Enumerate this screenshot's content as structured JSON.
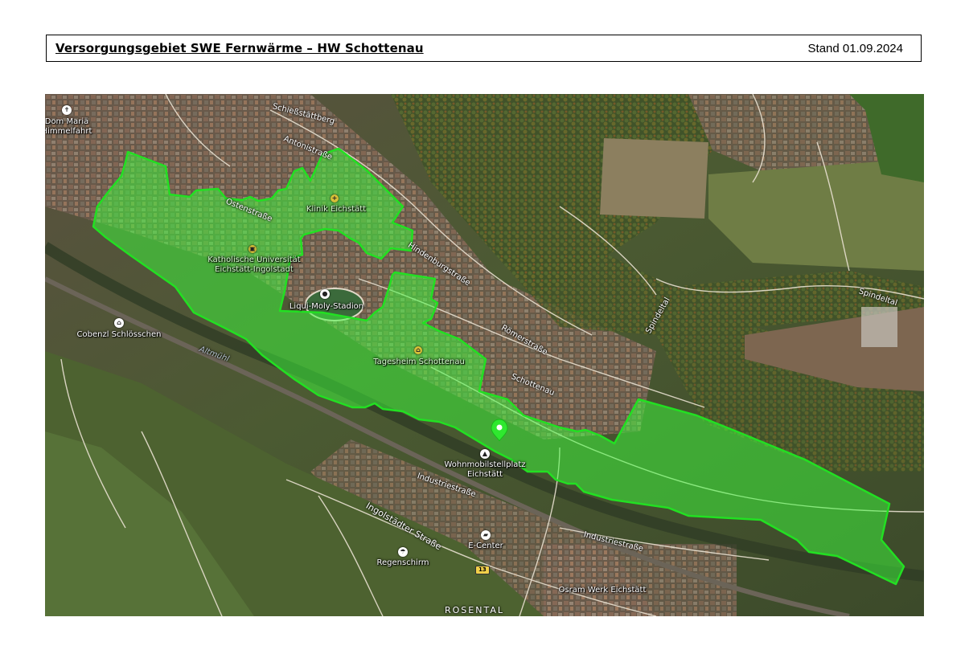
{
  "header": {
    "title": "Versorgungsgebiet SWE Fernwärme – HW Schottenau",
    "stand": "Stand 01.09.2024"
  },
  "map": {
    "places": {
      "dom": "Dom Mariä\nHimmelfahrt",
      "klinik": "Klinik Eichstätt",
      "uni": "Katholische Universität\nEichstätt-Ingolstadt",
      "stadion": "Liqui-Moly-Stadion",
      "cobenzl": "Cobenzl Schlösschen",
      "tagesheim": "Tagesheim Schottenau",
      "wohnmobil": "Wohnmobilstellplatz\nEichstätt",
      "ecenter": "E-Center",
      "regenschirm": "Regenschirm",
      "osram": "Osram Werk Eichstätt"
    },
    "roads": {
      "schiessstaette": "Schießstättberg",
      "antonistr": "Antonistraße",
      "ostenstr": "Ostenstraße",
      "hindenburg": "Hindenburgstraße",
      "roemer": "Römerstraße",
      "schottenau": "Schottenau",
      "spindeltal1": "Spindeltal",
      "spindeltal2": "Spindeltal",
      "industrie1": "Industriestraße",
      "industrie2": "Industriestraße",
      "ingolstaedter": "Ingolstädter Straße",
      "altmuehl": "Altmühl"
    },
    "shield": "13",
    "district": "ROSENTAL",
    "colors": {
      "area_fill": "#3bff3b",
      "area_stroke": "#22e022",
      "marker": "#2fe82f"
    }
  }
}
